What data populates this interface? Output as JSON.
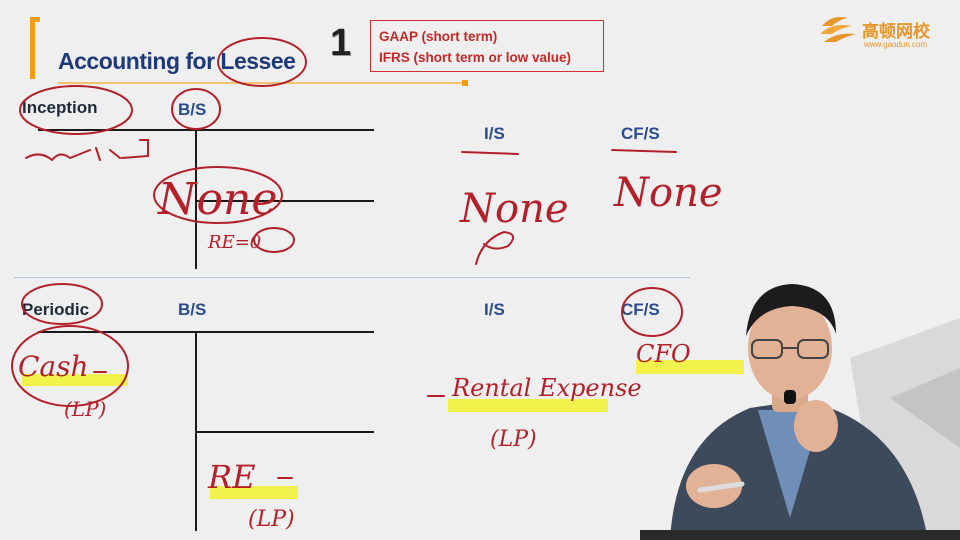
{
  "slide": {
    "title": "Accounting for Lessee",
    "number": "1",
    "note_lines": [
      "GAAP (short term)",
      "IFRS (short term or low value)"
    ]
  },
  "logo": {
    "name": "高顿网校",
    "url": "www.gaodun.com"
  },
  "inception": {
    "label": "Inception",
    "headers": {
      "bs": "B/S",
      "is": "I/S",
      "cfs": "CF/S"
    }
  },
  "periodic": {
    "label": "Periodic",
    "headers": {
      "bs": "B/S",
      "is": "I/S",
      "cfs": "CF/S"
    }
  },
  "handwriting": {
    "inception_none_bs": "None",
    "inception_none_is": "None",
    "inception_none_cfs": "None",
    "re_zero": "RE=0",
    "cash": "Cash",
    "cash_lp": "(LP)",
    "rental_expense": "Rental Expense",
    "rental_lp": "(LP)",
    "cfo": "CFO",
    "re": "RE",
    "re_lp": "(LP)"
  },
  "colors": {
    "title_blue": "#1f3a7a",
    "accent_orange": "#f39c12",
    "note_red": "#c62828",
    "ink_red": "#b3202a",
    "highlight_yellow": "#f2f23a"
  }
}
